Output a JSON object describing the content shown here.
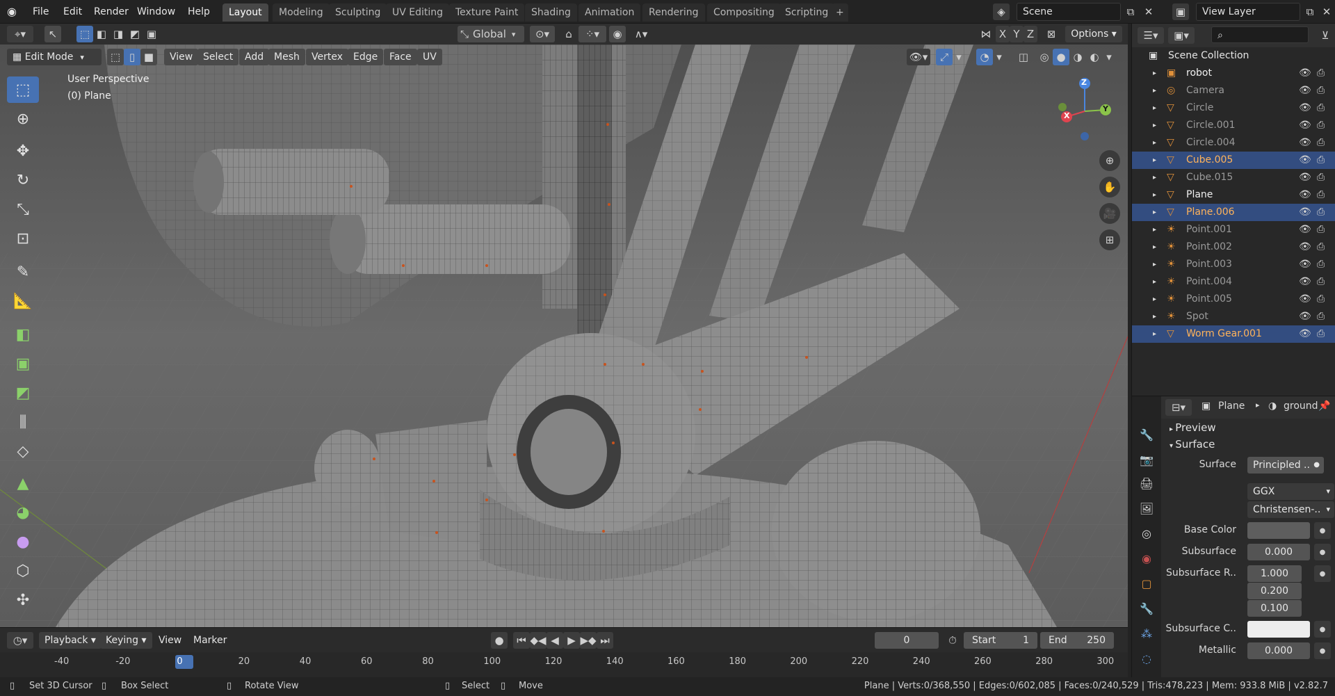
{
  "topbar": {
    "menus": [
      "File",
      "Edit",
      "Render",
      "Window",
      "Help"
    ],
    "workspace_tabs": [
      "Layout",
      "Modeling",
      "Sculpting",
      "UV Editing",
      "Texture Paint",
      "Shading",
      "Animation",
      "Rendering",
      "Compositing",
      "Scripting"
    ],
    "add_tab": "+",
    "scene_label": "Scene",
    "view_layer_label": "View Layer"
  },
  "viewport_header": {
    "mode": "Edit Mode",
    "menus": [
      "View",
      "Select",
      "Add",
      "Mesh",
      "Vertex",
      "Edge",
      "Face",
      "UV"
    ],
    "transform_orientation": "Global",
    "axes": [
      "X",
      "Y",
      "Z"
    ],
    "options_label": "Options"
  },
  "viewport": {
    "perspective_label": "User Perspective",
    "object_label": "(0) Plane",
    "gizmo": {
      "x": "X",
      "y": "Y",
      "z": "Z"
    }
  },
  "outliner": {
    "collection": "Scene Collection",
    "items": [
      {
        "name": "robot",
        "selected": false,
        "icon": "collection-icon"
      },
      {
        "name": "Camera",
        "selected": false,
        "icon": "camera-icon"
      },
      {
        "name": "Circle",
        "selected": false,
        "icon": "curve-icon"
      },
      {
        "name": "Circle.001",
        "selected": false,
        "icon": "curve-icon"
      },
      {
        "name": "Circle.004",
        "selected": false,
        "icon": "curve-icon"
      },
      {
        "name": "Cube.005",
        "selected": true,
        "icon": "mesh-icon"
      },
      {
        "name": "Cube.015",
        "selected": false,
        "icon": "mesh-icon"
      },
      {
        "name": "Plane",
        "selected": false,
        "icon": "mesh-icon"
      },
      {
        "name": "Plane.006",
        "selected": true,
        "icon": "mesh-icon"
      },
      {
        "name": "Point.001",
        "selected": false,
        "icon": "light-icon"
      },
      {
        "name": "Point.002",
        "selected": false,
        "icon": "light-icon"
      },
      {
        "name": "Point.003",
        "selected": false,
        "icon": "light-icon"
      },
      {
        "name": "Point.004",
        "selected": false,
        "icon": "light-icon"
      },
      {
        "name": "Point.005",
        "selected": false,
        "icon": "light-icon"
      },
      {
        "name": "Spot",
        "selected": false,
        "icon": "light-icon"
      },
      {
        "name": "Worm Gear.001",
        "selected": true,
        "icon": "mesh-icon"
      }
    ]
  },
  "properties": {
    "object": "Plane",
    "material": "ground",
    "panels": {
      "preview": "Preview",
      "surface": "Surface"
    },
    "rows": {
      "surface_label": "Surface",
      "surface_value": "Principled ..",
      "distribution": "GGX",
      "subsurface_method": "Christensen-..",
      "base_color_label": "Base Color",
      "subsurface_label": "Subsurface",
      "subsurface_value": "0.000",
      "subsurface_radius_label": "Subsurface R..",
      "subsurface_radius": [
        "1.000",
        "0.200",
        "0.100"
      ],
      "subsurface_color_label": "Subsurface C..",
      "metallic_label": "Metallic",
      "metallic_value": "0.000"
    }
  },
  "timeline": {
    "menus": [
      "Playback",
      "Keying",
      "View",
      "Marker"
    ],
    "current_frame": "0",
    "start_label": "Start",
    "start_value": "1",
    "end_label": "End",
    "end_value": "250",
    "ticks": [
      "-40",
      "-20",
      "0",
      "20",
      "40",
      "60",
      "80",
      "100",
      "120",
      "140",
      "160",
      "180",
      "200",
      "220",
      "240",
      "260",
      "280",
      "300"
    ]
  },
  "statusbar": {
    "hints": [
      "Set 3D Cursor",
      "Box Select",
      "Rotate View",
      "Select",
      "Move"
    ],
    "stats": "Plane | Verts:0/368,550 | Edges:0/602,085 | Faces:0/240,529 | Tris:478,223 | Mem: 933.8 MiB | v2.82.7"
  },
  "colors": {
    "accent": "#4772b3",
    "selected_row": "#334d80",
    "viewport_bg": "#5a5a5a",
    "axis_x": "#e0444f",
    "axis_y": "#8bc34a",
    "axis_z": "#4a86e0"
  }
}
